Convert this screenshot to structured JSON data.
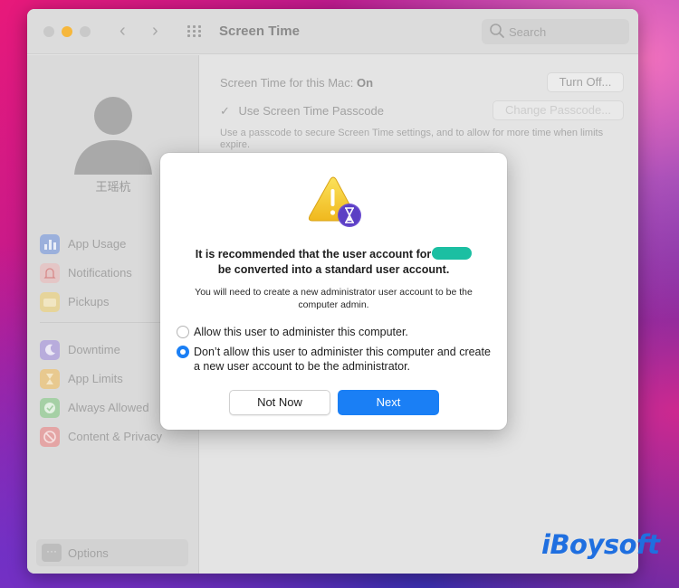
{
  "window": {
    "title": "Screen Time",
    "search_placeholder": "Search"
  },
  "sidebar": {
    "user_name": "王瑶杭",
    "group1": [
      {
        "label": "App Usage",
        "icon": "bar-chart-icon",
        "color": "#6f8fd8"
      },
      {
        "label": "Notifications",
        "icon": "bell-icon",
        "color": "#e07b7b"
      },
      {
        "label": "Pickups",
        "icon": "pickup-icon",
        "color": "#e6c870"
      }
    ],
    "group2": [
      {
        "label": "Downtime",
        "icon": "moon-icon",
        "color": "#a08fd8"
      },
      {
        "label": "App Limits",
        "icon": "hourglass-icon",
        "color": "#e6b870"
      },
      {
        "label": "Always Allowed",
        "icon": "checkmark-icon",
        "color": "#7fc47f"
      },
      {
        "label": "Content & Privacy",
        "icon": "no-entry-icon",
        "color": "#e07f7f"
      }
    ],
    "options_label": "Options"
  },
  "main": {
    "status_label": "Screen Time for this Mac:",
    "status_value": "On",
    "turn_off_label": "Turn Off...",
    "passcode_check": "✓",
    "passcode_label": "Use Screen Time Passcode",
    "change_passcode_label": "Change Passcode...",
    "description": "Use a passcode to secure Screen Time settings, and to allow for more time when limits expire."
  },
  "dialog": {
    "heading_part1": "It is recommended that the user account for",
    "heading_part2": "be converted into a standard user account.",
    "subtext": "You will need to create a new administrator user account to be the computer admin.",
    "option1": "Allow this user to administer this computer.",
    "option2": "Don’t allow this user to administer this computer and create a new user account to be the administrator.",
    "selected_option": 2,
    "not_now_label": "Not Now",
    "next_label": "Next",
    "accent_color": "#1a7ff5",
    "redaction_color": "#1bbfa2"
  },
  "watermark": "iBoysoft"
}
